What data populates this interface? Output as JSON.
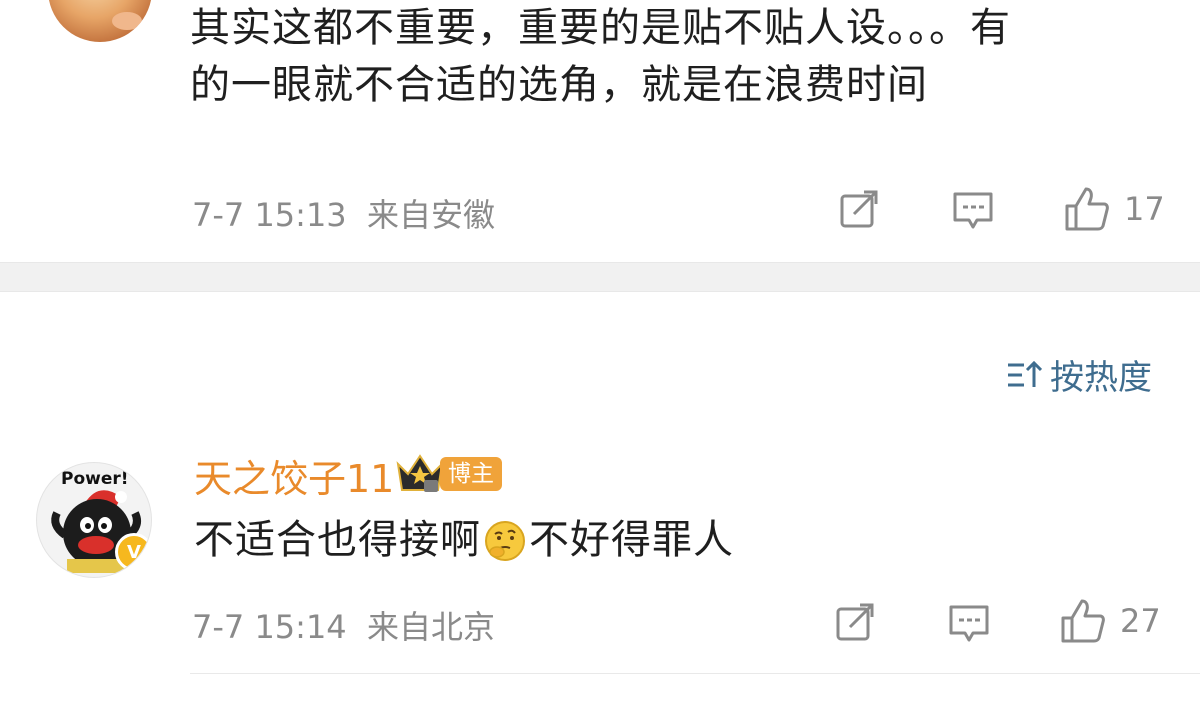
{
  "comments": [
    {
      "text_line1": "其实这都不重要，重要的是贴不贴人设。。。有",
      "text_line2": "的一眼就不合适的选角，就是在浪费时间",
      "meta": "7-7 15:13  来自安徽",
      "likes": "17"
    },
    {
      "username": "天之饺子11",
      "badge": "博主",
      "avatar_caption": "Power!",
      "text_part1": "不适合也得接啊",
      "text_part2": "不好得罪人",
      "meta": "7-7 15:14  来自北京",
      "likes": "27"
    }
  ],
  "sort": {
    "label": "按热度",
    "icon": "sort-icon"
  },
  "icons": {
    "share": "share-icon",
    "reply": "comment-icon",
    "like": "thumbs-up-icon",
    "emoji": "thinking-face-emoji"
  },
  "colors": {
    "username": "#e98a2b",
    "sort": "#3f6d8f",
    "meta": "#8a8a8a",
    "badge": "#f0a33a"
  }
}
